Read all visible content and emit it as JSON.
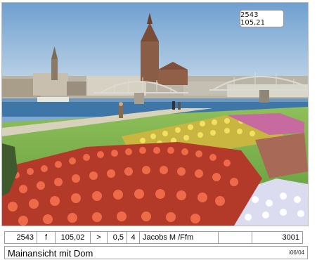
{
  "postcard": {
    "sticker_text": "2543 105,21"
  },
  "info_row": {
    "cells": [
      "2543",
      "f",
      "105,02",
      ">",
      "0,5",
      "4",
      "Jacobs M /Ffm",
      "",
      "3001"
    ]
  },
  "title_row": {
    "title": "Mainansicht mit Dom",
    "code": "i06/04"
  }
}
